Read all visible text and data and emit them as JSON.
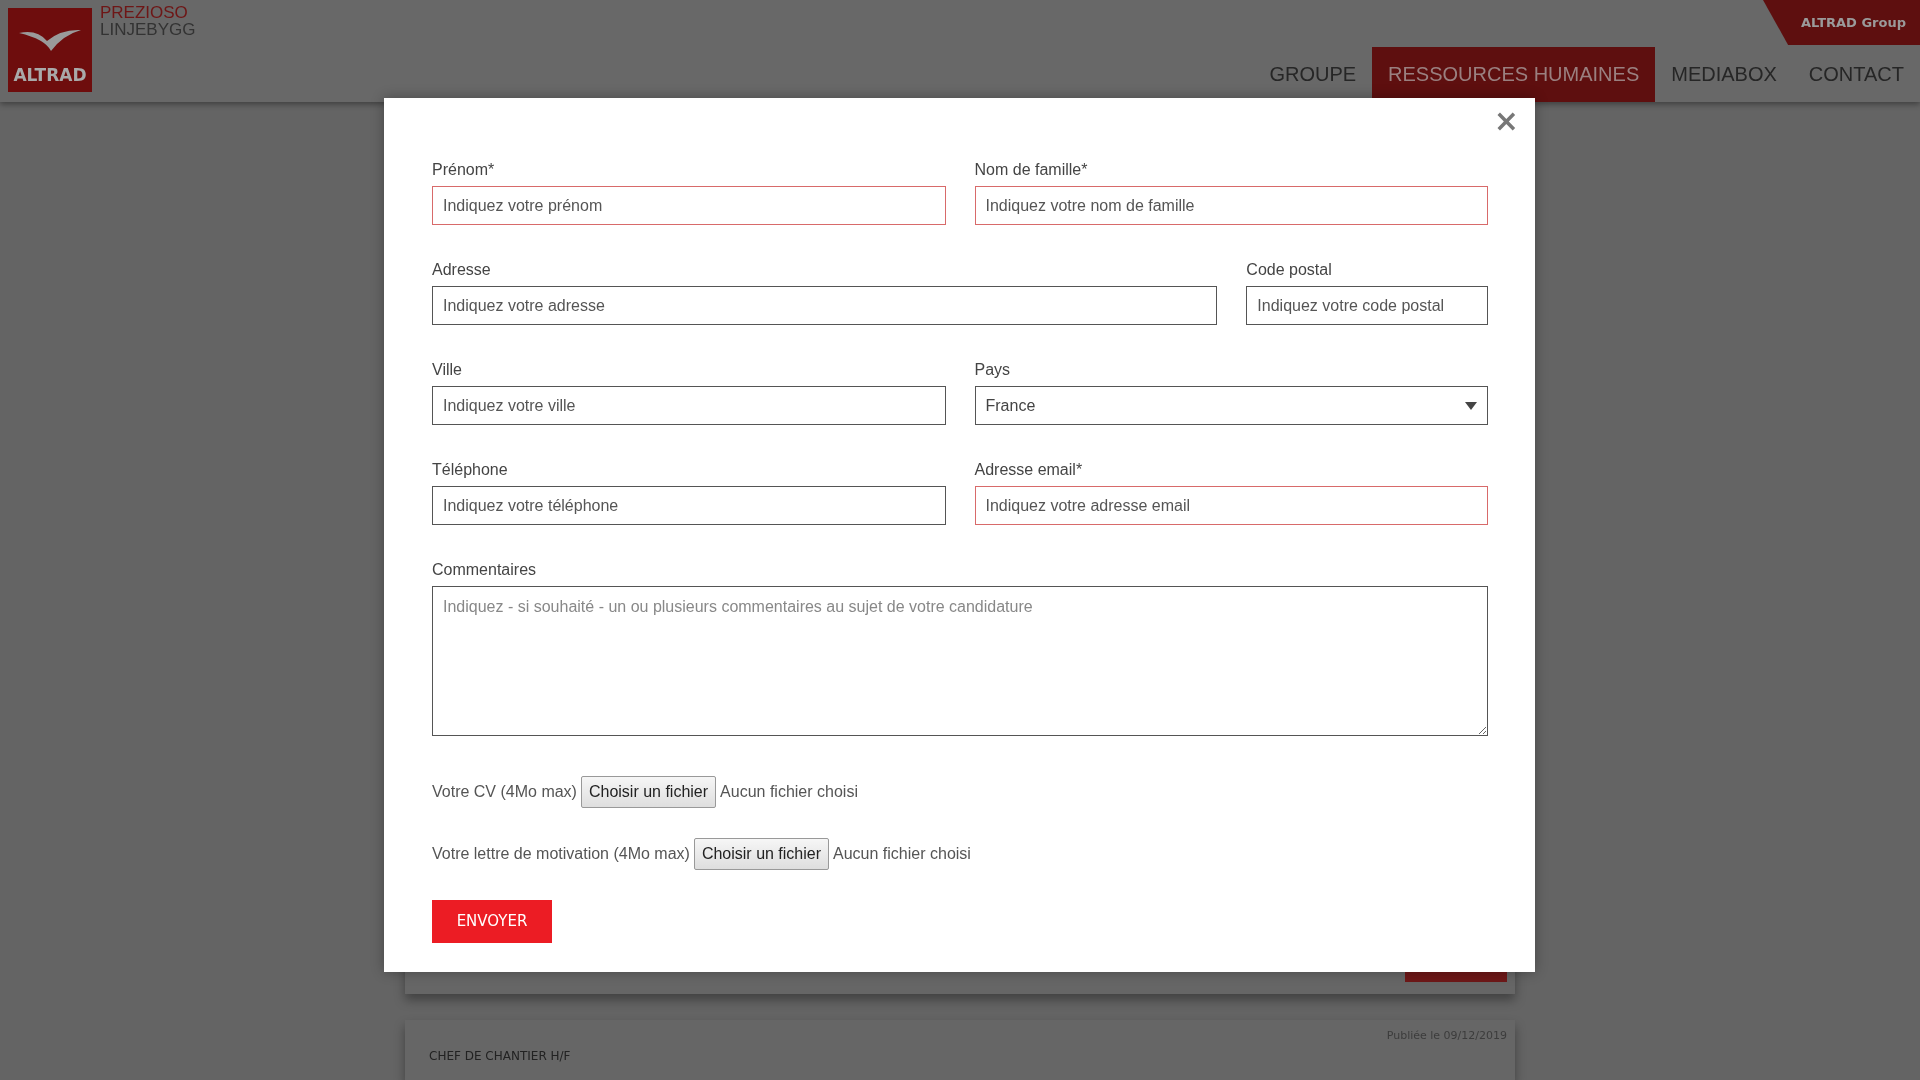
{
  "header": {
    "logo_text": "ALTRAD",
    "brand_line1": "PREZIOSO",
    "brand_line2": "LINJEBYGG",
    "group_link": "ALTRAD Group",
    "nav": [
      {
        "label": "GROUPE",
        "selected": false
      },
      {
        "label": "RESSOURCES HUMAINES",
        "selected": true
      },
      {
        "label": "MEDIABOX",
        "selected": false
      },
      {
        "label": "CONTACT",
        "selected": false
      }
    ]
  },
  "background": {
    "cards": [
      {
        "kind": "apply"
      },
      {
        "kind": "offer",
        "date": "Publiée le 09/12/2019",
        "title": "CHEF DE CHANTIER H/F"
      }
    ]
  },
  "modal": {
    "close": "×",
    "rows": [
      [
        {
          "kind": "input",
          "label": "Prénom*",
          "placeholder": "Indiquez votre prénom",
          "required": true
        },
        {
          "kind": "input",
          "label": "Nom de famille*",
          "placeholder": "Indiquez votre nom de famille",
          "required": true
        }
      ],
      [
        {
          "kind": "input",
          "label": "Adresse",
          "placeholder": "Indiquez votre adresse",
          "required": false
        },
        {
          "kind": "input",
          "label": "Code postal",
          "placeholder": "Indiquez votre code postal",
          "required": false
        }
      ],
      [
        {
          "kind": "input",
          "label": "Ville",
          "placeholder": "Indiquez votre ville",
          "required": false
        },
        {
          "kind": "select",
          "label": "Pays",
          "value": "France",
          "required": false
        }
      ],
      [
        {
          "kind": "input",
          "label": "Téléphone",
          "placeholder": "Indiquez votre téléphone",
          "required": false
        },
        {
          "kind": "input",
          "label": "Adresse email*",
          "placeholder": "Indiquez votre adresse email",
          "required": true
        }
      ],
      [
        {
          "kind": "textarea",
          "label": "Commentaires",
          "placeholder": "Indiquez - si souhaité - un ou plusieurs commentaires au sujet de votre candidature",
          "required": false
        }
      ]
    ],
    "files": [
      {
        "label": "Votre CV (4Mo max)",
        "button": "Choisir un fichier",
        "status": "Aucun fichier choisi"
      },
      {
        "label": "Votre lettre de motivation (4Mo max)",
        "button": "Choisir un fichier",
        "status": "Aucun fichier choisi"
      }
    ],
    "submit": "ENVOYER"
  }
}
